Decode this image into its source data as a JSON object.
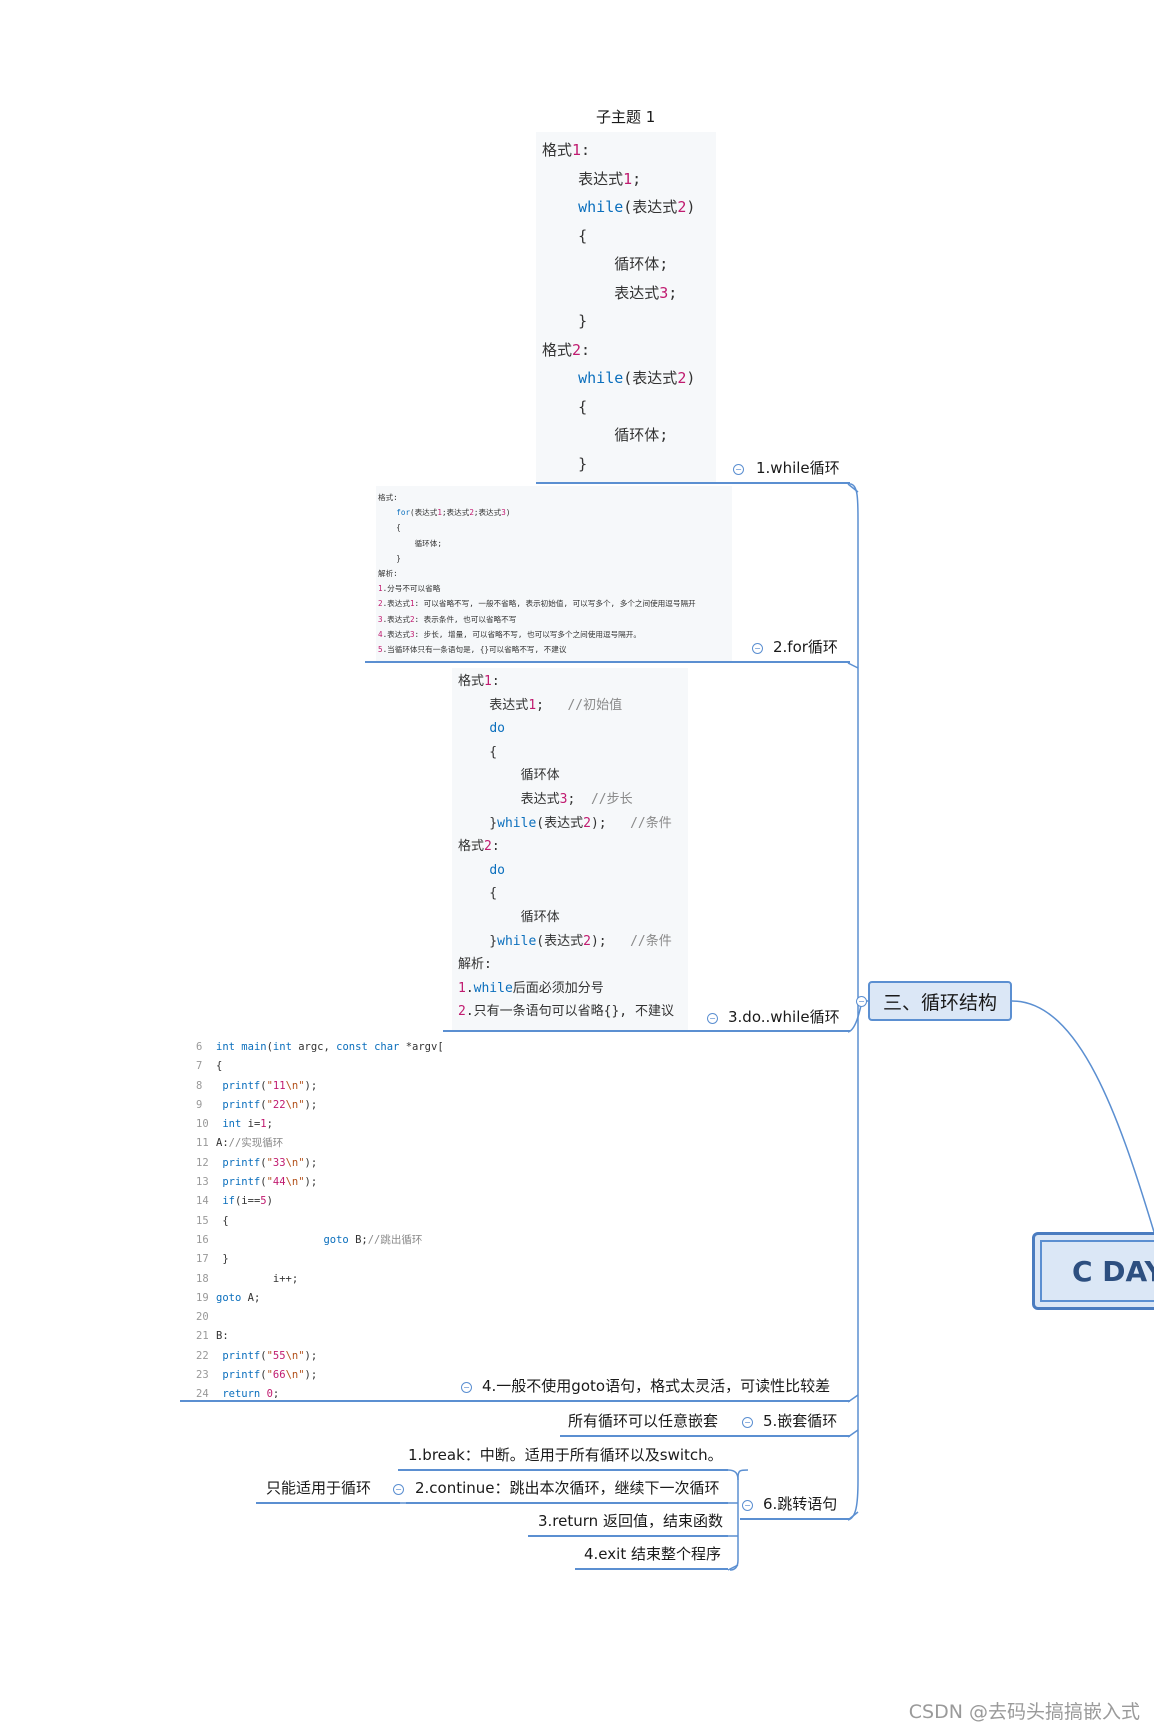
{
  "root": {
    "label": "C DAY"
  },
  "main_topic": {
    "label": "三、循环结构"
  },
  "subtopic_title": "子主题 1",
  "branches": [
    {
      "label": "1.while循环"
    },
    {
      "label": "2.for循环"
    },
    {
      "label": "3.do..while循环"
    },
    {
      "label": "4.一般不使用goto语句，格式太灵活，可读性比较差"
    },
    {
      "label": "5.嵌套循环",
      "child": "所有循环可以任意嵌套"
    },
    {
      "label": "6.跳转语句",
      "children": [
        {
          "label": "1.break：中断。适用于所有循环以及switch。"
        },
        {
          "label": "2.continue：跳出本次循环，继续下一次循环",
          "child": "只能适用于循环"
        },
        {
          "label": "3.return 返回值，结束函数"
        },
        {
          "label": "4.exit 结束整个程序"
        }
      ]
    }
  ],
  "while_code": [
    "格式1:",
    "    表达式1;",
    "    while(表达式2)",
    "    {",
    "        循环体;",
    "        表达式3;",
    "    }",
    "格式2:",
    "    while(表达式2)",
    "    {",
    "        循环体;",
    "    }"
  ],
  "for_code": [
    "格式:",
    "    for(表达式1;表达式2;表达式3)",
    "    {",
    "        循环体;",
    "    }",
    "解析:",
    "1.分号不可以省略",
    "2.表达式1: 可以省略不写, 一般不省略, 表示初始值, 可以写多个, 多个之间使用逗号隔开",
    "3.表达式2: 表示条件, 也可以省略不写",
    "4.表达式3: 步长, 增量, 可以省略不写, 也可以写多个之间使用逗号隔开。",
    "5.当循环体只有一条语句是, {}可以省略不写, 不建议"
  ],
  "dowhile_code": [
    "格式1:",
    "    表达式1;   //初始值",
    "    do",
    "    {",
    "        循环体",
    "        表达式3;  //步长",
    "    }while(表达式2);   //条件",
    "格式2:",
    "    do",
    "    {",
    "        循环体",
    "    }while(表达式2);   //条件",
    "解析:",
    "1.while后面必须加分号",
    "2.只有一条语句可以省略{}, 不建议"
  ],
  "goto_code": [
    {
      "no": "6",
      "text": "int main(int argc, const char *argv[])"
    },
    {
      "no": "7",
      "text": "{"
    },
    {
      "no": "8",
      "text": " printf(\"11\\n\");"
    },
    {
      "no": "9",
      "text": " printf(\"22\\n\");"
    },
    {
      "no": "10",
      "text": " int i=1;"
    },
    {
      "no": "11",
      "text": "A://实现循环"
    },
    {
      "no": "12",
      "text": " printf(\"33\\n\");"
    },
    {
      "no": "13",
      "text": " printf(\"44\\n\");"
    },
    {
      "no": "14",
      "text": " if(i==5)"
    },
    {
      "no": "15",
      "text": " {"
    },
    {
      "no": "16",
      "text": "                 goto B;//跳出循环"
    },
    {
      "no": "17",
      "text": " }"
    },
    {
      "no": "18",
      "text": "         i++;"
    },
    {
      "no": "19",
      "text": "goto A;"
    },
    {
      "no": "20",
      "text": ""
    },
    {
      "no": "21",
      "text": "B:"
    },
    {
      "no": "22",
      "text": " printf(\"55\\n\");"
    },
    {
      "no": "23",
      "text": " printf(\"66\\n\");"
    },
    {
      "no": "24",
      "text": " return 0;"
    }
  ],
  "watermark": "CSDN @去码头搞搞嵌入式",
  "colors": {
    "line": "#5b8fd1",
    "topic_fill": "#dbe7f6",
    "code_bg": "#f6f8fa",
    "keyword": "#0b6fbd",
    "number": "#c01a6f"
  }
}
